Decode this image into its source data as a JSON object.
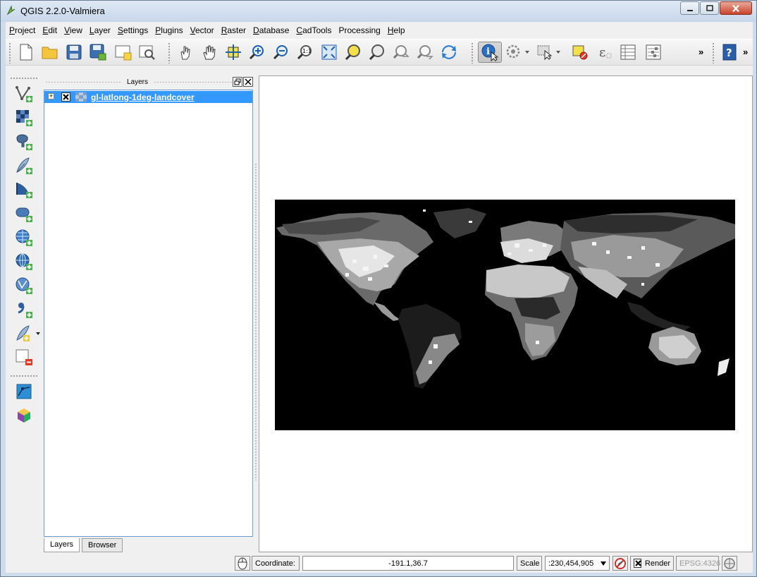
{
  "window": {
    "title": "QGIS 2.2.0-Valmiera"
  },
  "menu": {
    "items": [
      {
        "accel": "P",
        "rest": "roject"
      },
      {
        "accel": "E",
        "rest": "dit"
      },
      {
        "accel": "V",
        "rest": "iew"
      },
      {
        "accel": "L",
        "rest": "ayer"
      },
      {
        "accel": "S",
        "rest": "ettings"
      },
      {
        "accel": "P",
        "rest": "lugins"
      },
      {
        "accel": "V",
        "rest": "ector"
      },
      {
        "accel": "R",
        "rest": "aster"
      },
      {
        "accel": "D",
        "rest": "atabase"
      },
      {
        "accel": "C",
        "rest": "adTools"
      },
      {
        "accel": "",
        "rest": "Processing"
      },
      {
        "accel": "H",
        "rest": "elp"
      }
    ]
  },
  "toolbar": {
    "overflow": "»",
    "overflow2": "»"
  },
  "layers_panel": {
    "title": "Layers",
    "layer_name": "gl-latlong-1deg-landcover",
    "tabs": [
      "Layers",
      "Browser"
    ]
  },
  "status": {
    "coordinate_label": "Coordinate:",
    "coordinate_value": "-191.1,36.7",
    "scale_label": "Scale",
    "scale_value": ":230,454,905",
    "render_label": "Render",
    "crs": "EPSG:4326"
  }
}
